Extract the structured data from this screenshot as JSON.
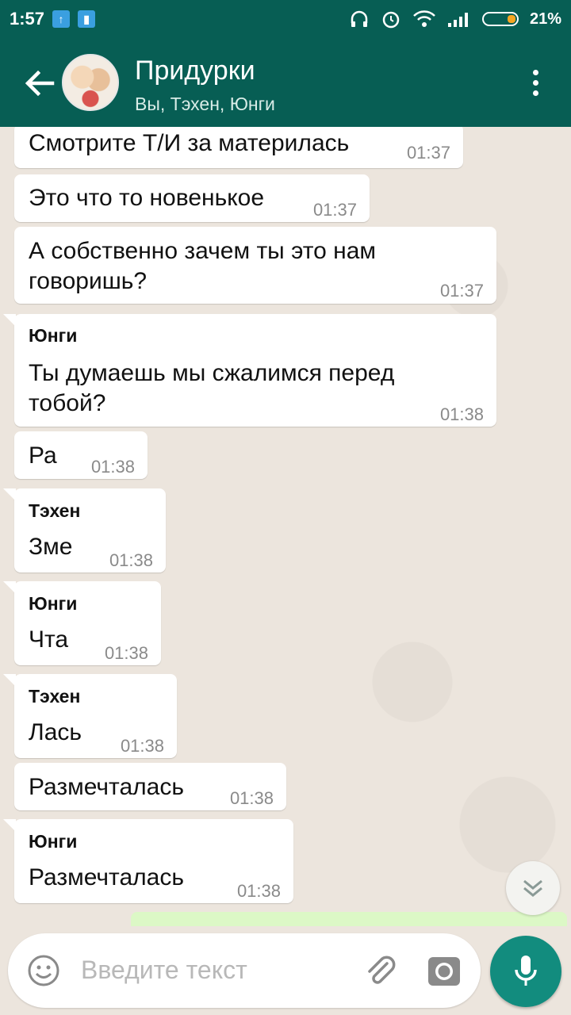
{
  "status_bar": {
    "time": "1:57",
    "battery_percent": "21%"
  },
  "header": {
    "title": "Придурки",
    "subtitle": "Вы, Тэхен, Юнги"
  },
  "messages": [
    {
      "sender": "",
      "text": "Смотрите Т/И за материлась",
      "time": "01:37"
    },
    {
      "sender": "",
      "text": "Это что то новенькое",
      "time": "01:37"
    },
    {
      "sender": "",
      "text": "А собственно зачем ты это нам говоришь?",
      "time": "01:37"
    },
    {
      "sender": "Юнги",
      "text": "Ты думаешь мы сжалимся перед тобой?",
      "time": "01:38"
    },
    {
      "sender": "",
      "text": "Ра",
      "time": "01:38"
    },
    {
      "sender": "Тэхен",
      "text": "Зме",
      "time": "01:38"
    },
    {
      "sender": "Юнги",
      "text": "Чта",
      "time": "01:38"
    },
    {
      "sender": "Тэхен",
      "text": "Лась",
      "time": "01:38"
    },
    {
      "sender": "",
      "text": "Размечталась",
      "time": "01:38"
    },
    {
      "sender": "Юнги",
      "text": "Размечталась",
      "time": "01:38"
    }
  ],
  "input": {
    "placeholder": "Введите текст"
  },
  "colors": {
    "header_bg": "#075e54",
    "mic_button": "#128c7e",
    "chat_bg": "#ece5dd",
    "outgoing_bubble": "#dcf8c6"
  }
}
